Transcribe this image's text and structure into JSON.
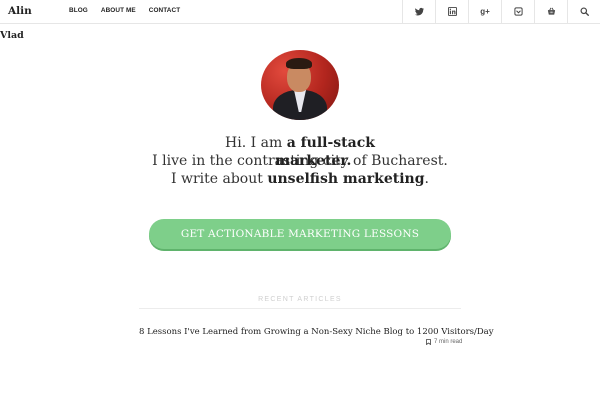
{
  "brand": {
    "first": "Alin",
    "second": "Vlad"
  },
  "nav": [
    {
      "label": "BLOG"
    },
    {
      "label": "ABOUT ME"
    },
    {
      "label": "CONTACT"
    }
  ],
  "social": [
    {
      "icon": "twitter-icon"
    },
    {
      "icon": "linkedin-icon"
    },
    {
      "icon": "google-plus-icon",
      "glyph": "g+"
    },
    {
      "icon": "inbox-icon"
    },
    {
      "icon": "basket-icon"
    },
    {
      "icon": "search-icon"
    }
  ],
  "hero": {
    "line1_prefix": "Hi. I am ",
    "line1_bold": "a full-stack",
    "line2_prefix": "I live in the contrasting city of Bucharest.",
    "line2_overlap": "marketer.",
    "line3_prefix": "I write about ",
    "line3_bold": "unselfish marketing",
    "line3_suffix": "."
  },
  "cta": {
    "label": "GET ACTIONABLE MARKETING LESSONS"
  },
  "recent": {
    "heading": "RECENT ARTICLES",
    "articles": [
      {
        "title": "8 Lessons I've Learned from Growing a Non-Sexy Niche Blog to 1200 Visitors/Day",
        "read_time": "7 min read"
      }
    ]
  },
  "colors": {
    "cta": "#7ecf8a",
    "text": "#333333",
    "muted": "#cfcfcf"
  }
}
